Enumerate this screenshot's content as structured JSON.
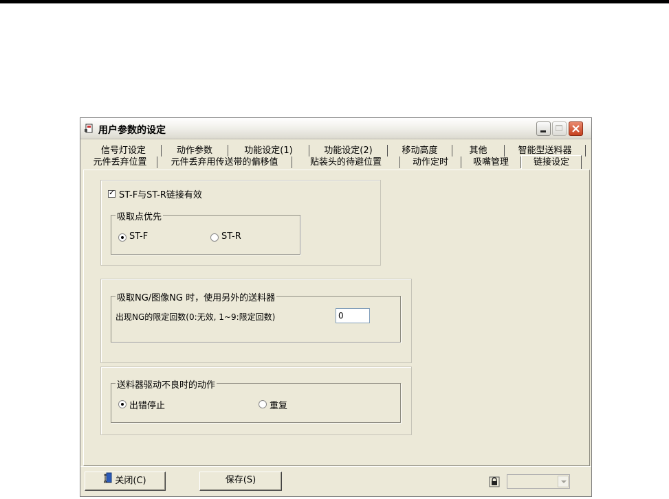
{
  "window": {
    "title": "用户参数的设定"
  },
  "tabs_row1": [
    {
      "label": "信号灯设定"
    },
    {
      "label": "动作参数"
    },
    {
      "label": "功能设定(1)"
    },
    {
      "label": "功能设定(2)"
    },
    {
      "label": "移动高度"
    },
    {
      "label": "其他"
    },
    {
      "label": "智能型送料器"
    }
  ],
  "tabs_row2": [
    {
      "label": "元件丢弃位置"
    },
    {
      "label": "元件丢弃用传送带的偏移值"
    },
    {
      "label": "贴装头的待避位置"
    },
    {
      "label": "动作定时"
    },
    {
      "label": "吸嘴管理"
    },
    {
      "label": "链接设定",
      "active": true
    }
  ],
  "link": {
    "checkbox_label": "ST-F与ST-R链接有效",
    "checked": true,
    "priority_group": "吸取点优先",
    "opt_f": "ST-F",
    "opt_r": "ST-R",
    "selected": "ST-F"
  },
  "ng": {
    "group": "吸取NG/图像NG 时，使用另外的送料器",
    "label": "出现NG的限定回数(0:无效, 1~9:限定回数)",
    "value": "0"
  },
  "feeder_fault": {
    "group": "送料器驱动不良时的动作",
    "opt_stop": "出错停止",
    "opt_repeat": "重复",
    "selected": "出错停止"
  },
  "buttons": {
    "close": "关闭(C)",
    "save": "保存(S)"
  },
  "combo": {
    "value": ""
  },
  "colors": {
    "close_button": "#c6401f",
    "dialog_bg": "#ece9d8"
  }
}
